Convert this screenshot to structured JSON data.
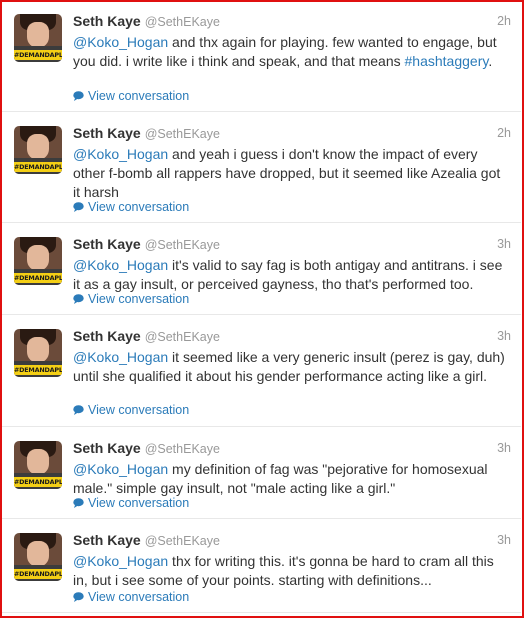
{
  "tweets": [
    {
      "name": "Seth Kaye",
      "handle": "@SethEKaye",
      "time": "2h",
      "mention": "@Koko_Hogan",
      "text": " and thx again for playing. few wanted to engage, but you did. i write like i think and speak, and that means ",
      "hashtag": "#hashtaggery",
      "after": ".",
      "action": "View conversation",
      "avatar_banner": "#DEMANDAPLAN"
    },
    {
      "name": "Seth Kaye",
      "handle": "@SethEKaye",
      "time": "2h",
      "mention": "@Koko_Hogan",
      "text": " and yeah i guess i don't know the impact of every other f-bomb all rappers have dropped, but it seemed like Azealia got it harsh",
      "hashtag": "",
      "after": "",
      "action": "View conversation",
      "avatar_banner": "#DEMANDAPLAN"
    },
    {
      "name": "Seth Kaye",
      "handle": "@SethEKaye",
      "time": "3h",
      "mention": "@Koko_Hogan",
      "text": " it's valid to say fag is both antigay and antitrans. i see it as a gay insult, or perceived gayness, tho that's performed too.",
      "hashtag": "",
      "after": "",
      "action": "View conversation",
      "avatar_banner": "#DEMANDAPLAN"
    },
    {
      "name": "Seth Kaye",
      "handle": "@SethEKaye",
      "time": "3h",
      "mention": "@Koko_Hogan",
      "text": " it seemed like a very generic insult (perez is gay, duh) until she qualified it about his gender performance acting like a girl.",
      "hashtag": "",
      "after": "",
      "action": "View conversation",
      "avatar_banner": "#DEMANDAPLAN"
    },
    {
      "name": "Seth Kaye",
      "handle": "@SethEKaye",
      "time": "3h",
      "mention": "@Koko_Hogan",
      "text": " my definition of fag was \"pejorative for homosexual male.\" simple gay insult, not \"male acting like a girl.\"",
      "hashtag": "",
      "after": "",
      "action": "View conversation",
      "avatar_banner": "#DEMANDAPLAN"
    },
    {
      "name": "Seth Kaye",
      "handle": "@SethEKaye",
      "time": "3h",
      "mention": "@Koko_Hogan",
      "text": " thx for writing this. it's gonna be hard to cram all this in, but i see some of your points. starting with definitions...",
      "hashtag": "",
      "after": "",
      "action": "View conversation",
      "avatar_banner": "#DEMANDAPLAN"
    }
  ],
  "colors": {
    "link": "#2b7bb9",
    "text": "#333333",
    "muted": "#999999",
    "frame": "#e01010"
  }
}
